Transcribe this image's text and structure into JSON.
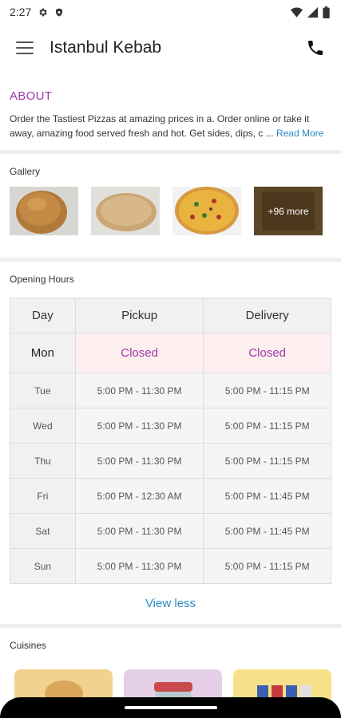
{
  "status_bar": {
    "time": "2:27"
  },
  "app_bar": {
    "title": "Istanbul Kebab"
  },
  "about": {
    "heading": "ABOUT",
    "text": "Order the Tastiest Pizzas at amazing prices in a. Order online or take it away, amazing food served fresh and hot. Get sides, dips, c ...",
    "read_more": "Read More"
  },
  "gallery": {
    "label": "Gallery",
    "more_label": "+96 more"
  },
  "opening_hours": {
    "label": "Opening Hours",
    "headers": [
      "Day",
      "Pickup",
      "Delivery"
    ],
    "today": {
      "day": "Mon",
      "pickup": "Closed",
      "delivery": "Closed"
    },
    "rows": [
      {
        "day": "Tue",
        "pickup": "5:00 PM - 11:30 PM",
        "delivery": "5:00 PM - 11:15 PM"
      },
      {
        "day": "Wed",
        "pickup": "5:00 PM - 11:30 PM",
        "delivery": "5:00 PM - 11:15 PM"
      },
      {
        "day": "Thu",
        "pickup": "5:00 PM - 11:30 PM",
        "delivery": "5:00 PM - 11:15 PM"
      },
      {
        "day": "Fri",
        "pickup": "5:00 PM - 12:30 AM",
        "delivery": "5:00 PM - 11:45 PM"
      },
      {
        "day": "Sat",
        "pickup": "5:00 PM - 11:30 PM",
        "delivery": "5:00 PM - 11:45 PM"
      },
      {
        "day": "Sun",
        "pickup": "5:00 PM - 11:30 PM",
        "delivery": "5:00 PM - 11:15 PM"
      }
    ],
    "view_less": "View less"
  },
  "cuisines": {
    "label": "Cuisines"
  },
  "colors": {
    "accent": "#9b3aa6",
    "link": "#2b8cc4"
  }
}
